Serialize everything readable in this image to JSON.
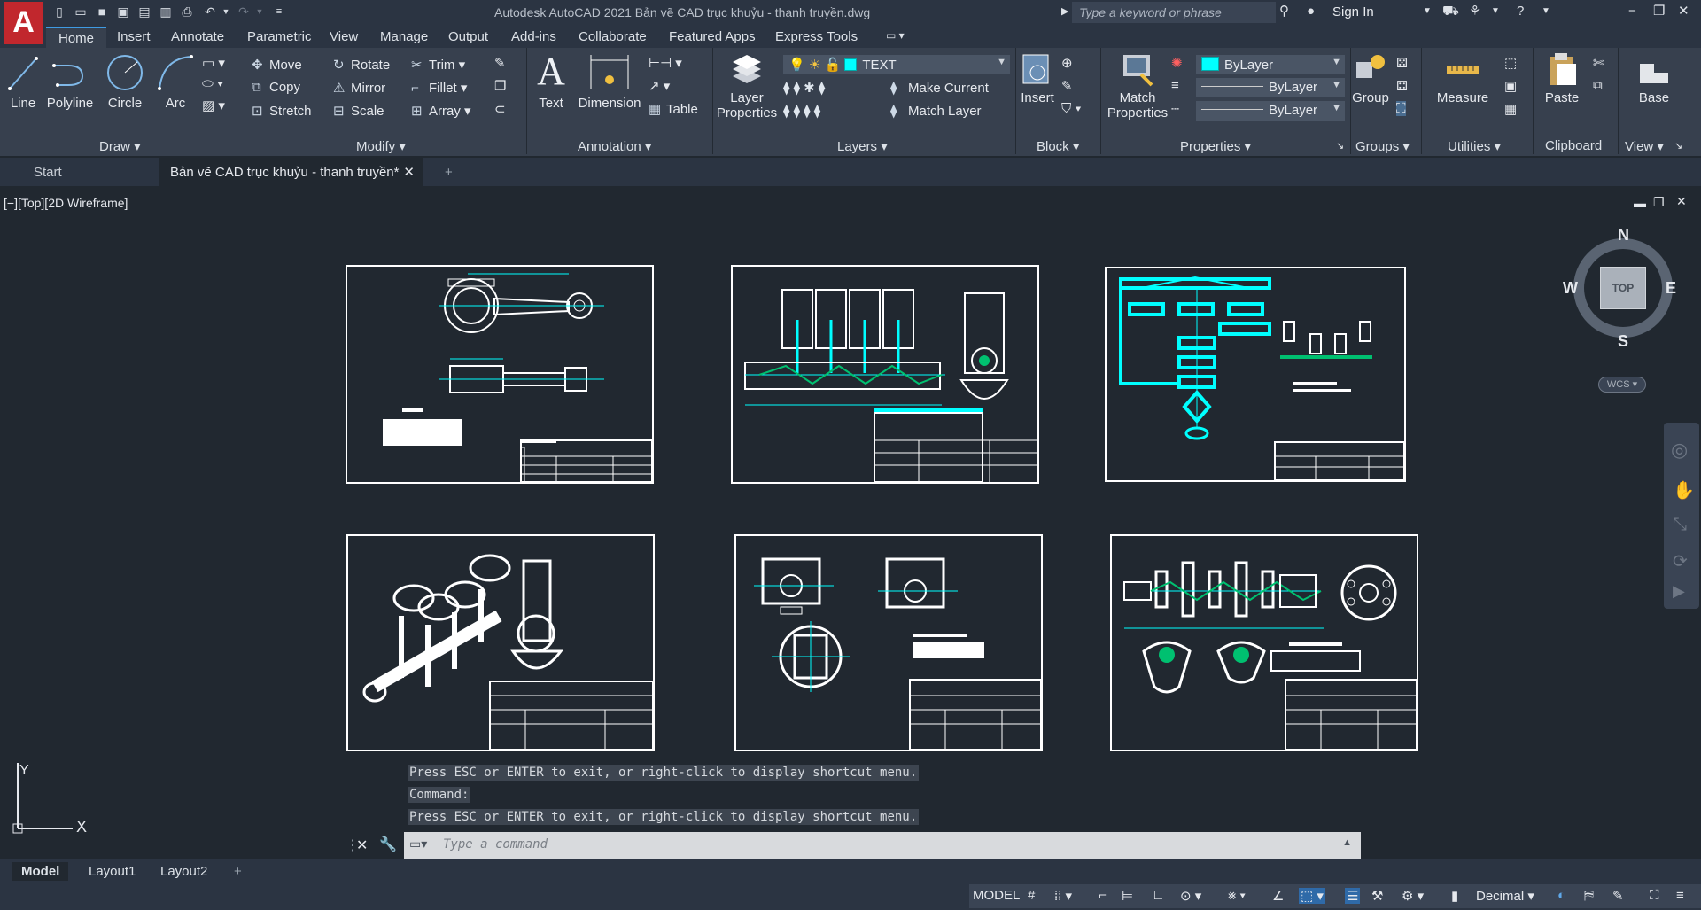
{
  "app": {
    "logo_letter": "A",
    "title": "Autodesk AutoCAD 2021    Bản vẽ CAD trục khuỷu - thanh truyền.dwg",
    "search_placeholder": "Type a keyword or phrase",
    "sign_in": "Sign In"
  },
  "ribbon_tabs": [
    "Home",
    "Insert",
    "Annotate",
    "Parametric",
    "View",
    "Manage",
    "Output",
    "Add-ins",
    "Collaborate",
    "Featured Apps",
    "Express Tools"
  ],
  "ribbon": {
    "draw": {
      "title": "Draw",
      "line": "Line",
      "polyline": "Polyline",
      "circle": "Circle",
      "arc": "Arc"
    },
    "modify": {
      "title": "Modify",
      "move": "Move",
      "rotate": "Rotate",
      "trim": "Trim",
      "copy": "Copy",
      "mirror": "Mirror",
      "fillet": "Fillet",
      "stretch": "Stretch",
      "scale": "Scale",
      "array": "Array"
    },
    "annotation": {
      "title": "Annotation",
      "text": "Text",
      "dimension": "Dimension",
      "table": "Table"
    },
    "layers": {
      "title": "Layers",
      "properties_line1": "Layer",
      "properties_line2": "Properties",
      "current_layer": "TEXT",
      "make_current": "Make Current",
      "match_layer": "Match Layer"
    },
    "block": {
      "title": "Block",
      "insert": "Insert"
    },
    "properties": {
      "title": "Properties",
      "match_line1": "Match",
      "match_line2": "Properties",
      "color": "ByLayer",
      "linetype": "ByLayer",
      "lineweight": "ByLayer"
    },
    "groups": {
      "title": "Groups",
      "group": "Group"
    },
    "utilities": {
      "title": "Utilities",
      "measure": "Measure"
    },
    "clipboard": {
      "title": "Clipboard",
      "paste": "Paste"
    },
    "view": {
      "title": "View",
      "base": "Base"
    }
  },
  "file_tabs": {
    "start": "Start",
    "document": "Bản vẽ CAD trục khuỷu - thanh truyền*"
  },
  "viewport": {
    "label": "[−][Top][2D Wireframe]"
  },
  "viewcube": {
    "n": "N",
    "s": "S",
    "e": "E",
    "w": "W",
    "face": "TOP",
    "wcs": "WCS"
  },
  "ucs": {
    "x": "X",
    "y": "Y"
  },
  "command": {
    "history": [
      "Press ESC or ENTER to exit, or right-click to display shortcut menu.",
      "Command:",
      "Press ESC or ENTER to exit, or right-click to display shortcut menu."
    ],
    "placeholder": "Type a command"
  },
  "layout_tabs": [
    "Model",
    "Layout1",
    "Layout2"
  ],
  "status": {
    "model": "MODEL",
    "units": "Decimal"
  },
  "colors": {
    "accent": "#3f9be3",
    "cyan": "#00ffff",
    "logo": "#c1272d",
    "drawing": "#ffffff",
    "green": "#00c070"
  }
}
